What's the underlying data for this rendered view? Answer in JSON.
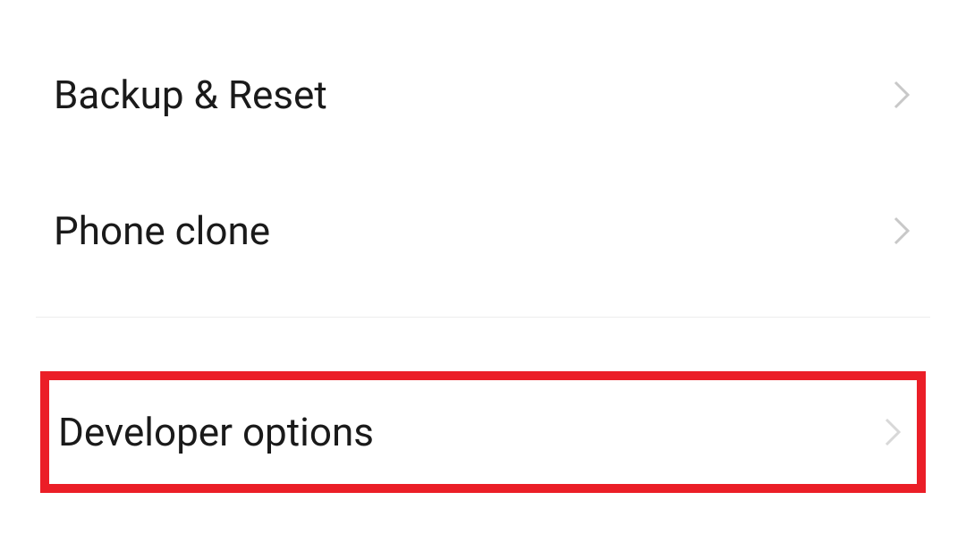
{
  "settings": {
    "items": [
      {
        "label": "Backup & Reset"
      },
      {
        "label": "Phone clone"
      },
      {
        "label": "Developer options"
      }
    ]
  }
}
